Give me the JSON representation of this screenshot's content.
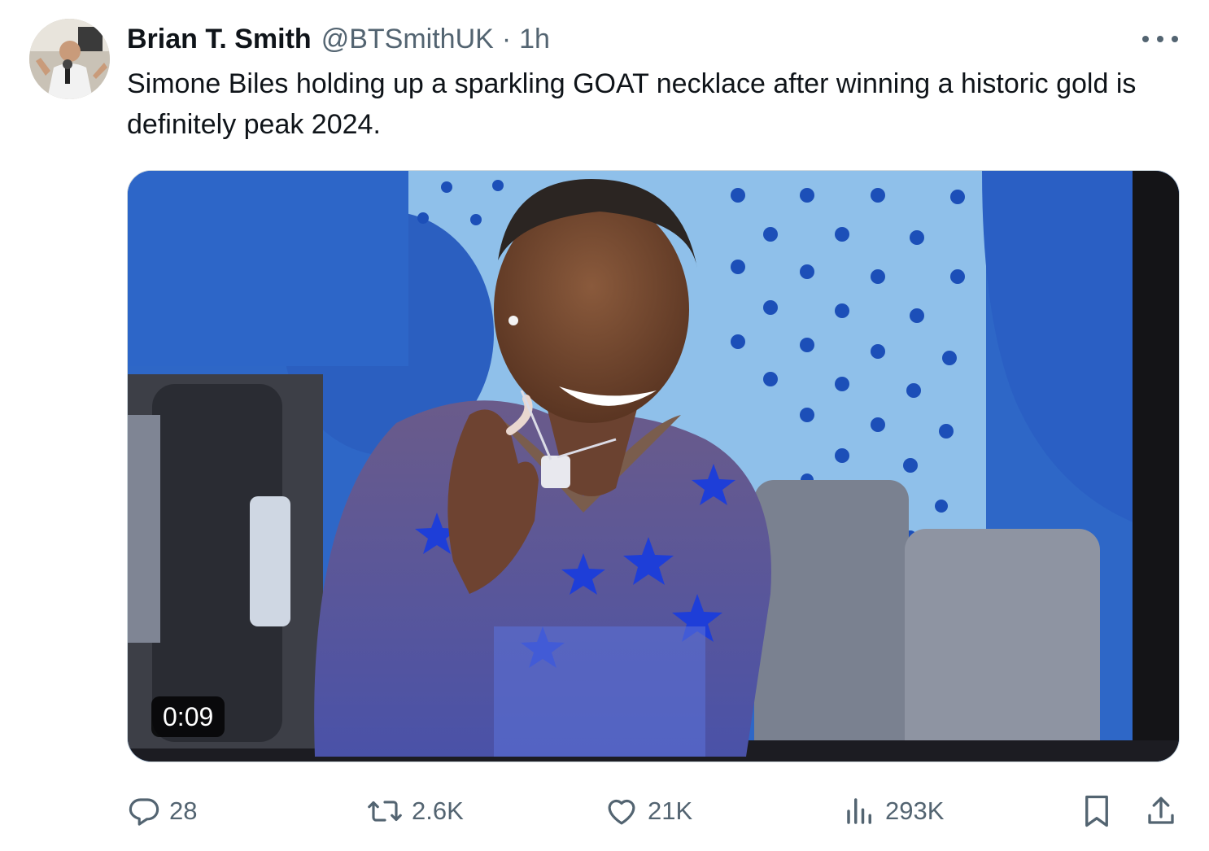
{
  "tweet": {
    "author_name": "Brian T. Smith",
    "author_handle": "@BTSmithUK",
    "separator": "·",
    "time": "1h",
    "text": "Simone Biles holding up a sparkling GOAT necklace after winning a historic gold is definitely peak 2024.",
    "media": {
      "type": "video",
      "duration": "0:09"
    }
  },
  "actions": {
    "replies": "28",
    "reposts": "2.6K",
    "likes": "21K",
    "views": "293K"
  },
  "icons": {
    "more": "more-icon",
    "reply": "reply-icon",
    "repost": "repost-icon",
    "like": "heart-icon",
    "views": "views-icon",
    "bookmark": "bookmark-icon",
    "share": "share-icon"
  },
  "colors": {
    "text_primary": "#0f1419",
    "text_secondary": "#536471",
    "border": "#cfd9de"
  }
}
